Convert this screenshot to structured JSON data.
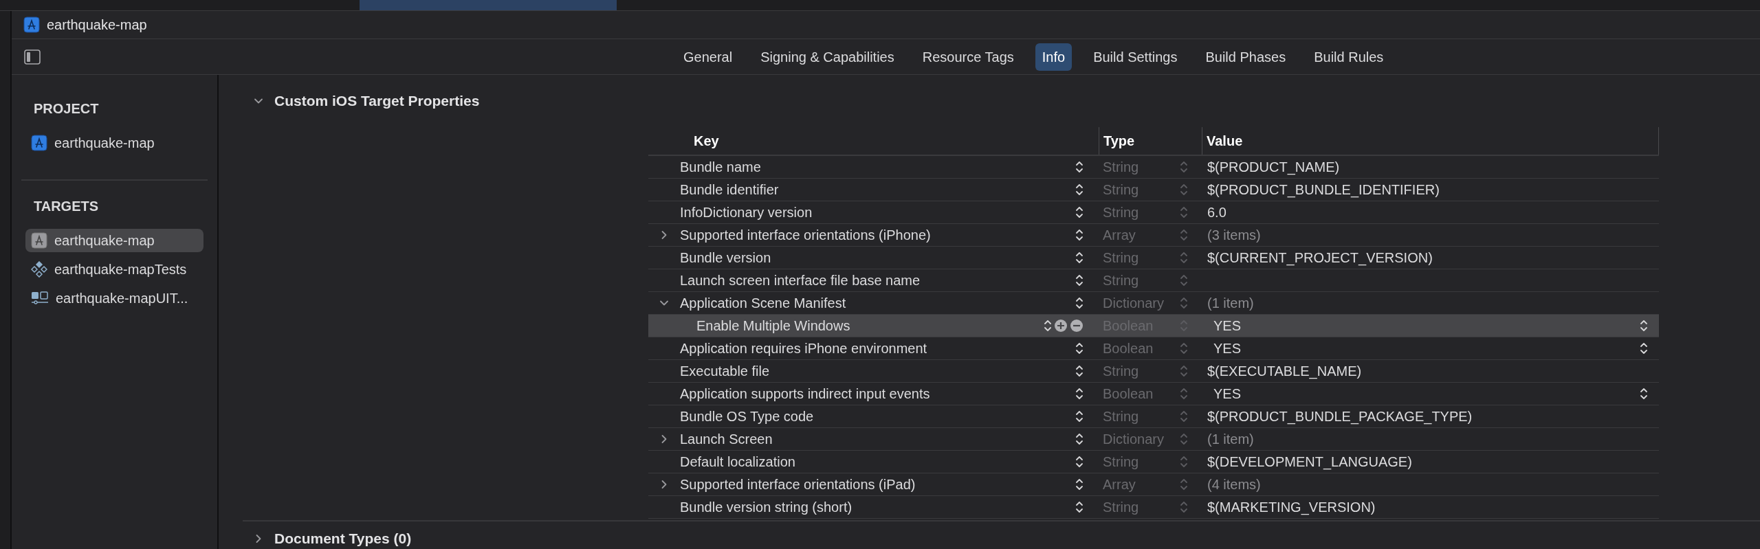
{
  "window": {
    "title": "earthquake-map"
  },
  "tabs": [
    {
      "label": "General",
      "selected": false
    },
    {
      "label": "Signing & Capabilities",
      "selected": false
    },
    {
      "label": "Resource Tags",
      "selected": false
    },
    {
      "label": "Info",
      "selected": true
    },
    {
      "label": "Build Settings",
      "selected": false
    },
    {
      "label": "Build Phases",
      "selected": false
    },
    {
      "label": "Build Rules",
      "selected": false
    }
  ],
  "sidebar": {
    "sections": [
      {
        "heading": "PROJECT",
        "items": [
          {
            "label": "earthquake-map",
            "kind": "project",
            "selected": false
          }
        ]
      },
      {
        "heading": "TARGETS",
        "items": [
          {
            "label": "earthquake-map",
            "kind": "app",
            "selected": true
          },
          {
            "label": "earthquake-mapTests",
            "kind": "tests",
            "selected": false
          },
          {
            "label": "earthquake-mapUIT...",
            "kind": "uitests",
            "selected": false
          }
        ]
      }
    ]
  },
  "sections": [
    {
      "title": "Custom iOS Target Properties",
      "expanded": true,
      "table": {
        "columns": [
          "Key",
          "Type",
          "Value"
        ],
        "rows": [
          {
            "key": "Bundle name",
            "type": "String",
            "value": "$(PRODUCT_NAME)",
            "kind": "text",
            "expandable": false,
            "selected": false
          },
          {
            "key": "Bundle identifier",
            "type": "String",
            "value": "$(PRODUCT_BUNDLE_IDENTIFIER)",
            "kind": "text",
            "expandable": false,
            "selected": false
          },
          {
            "key": "InfoDictionary version",
            "type": "String",
            "value": "6.0",
            "kind": "text",
            "expandable": false,
            "selected": false
          },
          {
            "key": "Supported interface orientations (iPhone)",
            "type": "Array",
            "value": "(3 items)",
            "kind": "count",
            "expandable": true,
            "expanded": false,
            "selected": false
          },
          {
            "key": "Bundle version",
            "type": "String",
            "value": "$(CURRENT_PROJECT_VERSION)",
            "kind": "text",
            "expandable": false,
            "selected": false
          },
          {
            "key": "Launch screen interface file base name",
            "type": "String",
            "kind": "text",
            "expandable": false,
            "selected": false
          },
          {
            "key": "Application Scene Manifest",
            "type": "Dictionary",
            "value": "(1 item)",
            "kind": "count",
            "expandable": true,
            "expanded": true,
            "selected": false,
            "children": [
              {
                "key": "Enable Multiple Windows",
                "type": "Boolean",
                "value": "YES",
                "kind": "bool",
                "expandable": false,
                "selected": true
              }
            ]
          },
          {
            "key": "Application requires iPhone environment",
            "type": "Boolean",
            "value": "YES",
            "kind": "bool",
            "expandable": false,
            "selected": false
          },
          {
            "key": "Executable file",
            "type": "String",
            "value": "$(EXECUTABLE_NAME)",
            "kind": "text",
            "expandable": false,
            "selected": false
          },
          {
            "key": "Application supports indirect input events",
            "type": "Boolean",
            "value": "YES",
            "kind": "bool",
            "expandable": false,
            "selected": false
          },
          {
            "key": "Bundle OS Type code",
            "type": "String",
            "value": "$(PRODUCT_BUNDLE_PACKAGE_TYPE)",
            "kind": "text",
            "expandable": false,
            "selected": false
          },
          {
            "key": "Launch Screen",
            "type": "Dictionary",
            "value": "(1 item)",
            "kind": "count",
            "expandable": true,
            "expanded": false,
            "selected": false
          },
          {
            "key": "Default localization",
            "type": "String",
            "value": "$(DEVELOPMENT_LANGUAGE)",
            "kind": "text",
            "expandable": false,
            "selected": false
          },
          {
            "key": "Supported interface orientations (iPad)",
            "type": "Array",
            "value": "(4 items)",
            "kind": "count",
            "expandable": true,
            "expanded": false,
            "selected": false
          },
          {
            "key": "Bundle version string (short)",
            "type": "String",
            "value": "$(MARKETING_VERSION)",
            "kind": "text",
            "expandable": false,
            "selected": false
          }
        ]
      }
    },
    {
      "title": "Document Types (0)",
      "expanded": false
    }
  ]
}
